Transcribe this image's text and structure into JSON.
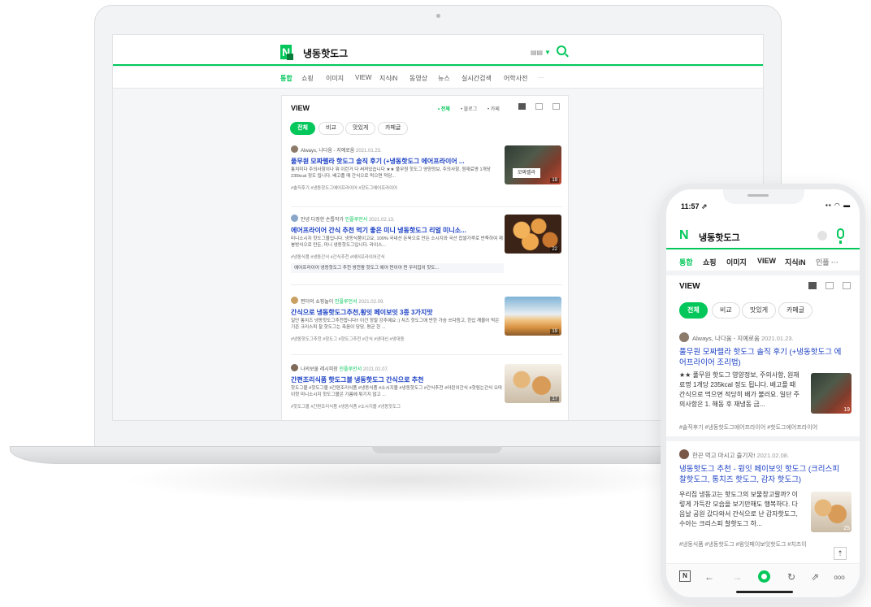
{
  "laptop": {
    "query": "냉동핫도그",
    "tabs": [
      "통합",
      "쇼핑",
      "이미지",
      "VIEW",
      "지식iN",
      "동영상",
      "뉴스",
      "실시간검색",
      "어학사전",
      "···"
    ],
    "view_title": "VIEW",
    "filters": [
      "• 전체",
      "• 블로그",
      "• 카페"
    ],
    "chips": [
      "전체",
      "비교",
      "맛있게",
      "카페글"
    ],
    "posts": [
      {
        "author": "Always, 나다움 - 지예로움",
        "influencer": "",
        "date": "2021.01.23.",
        "title": "풀무원 모짜렐라 핫도그 솔직 후기 (+냉동핫도그 에어프라이어 ...",
        "body": "통치미다 주의사항이나 뭐 이런거 다 써져있습니다 ★★ 풀무원 핫도그 영양정보, 주의사항, 원재료명 1개당 235kcal 정도 됩니다. 배고플 때 간식으로 먹으면 적당...",
        "tags": "#솔직후기   #냉동핫도그에어프라이어   #핫도그에어프라이어",
        "related": "",
        "thumb_label": "모짜렐라",
        "thumb_count": "19"
      },
      {
        "author": "안녕 다정한 손톱작가",
        "influencer": "인플루언서",
        "date": "2021.02.13.",
        "title": "에어프라이어 간식 추천 먹기 좋은 미니 냉동핫도그 리얼 미니소...",
        "body": "미니소시지 핫도그몰입니다. 냉동식품이고요, 100% 국내산 돈육으로 만든 소시지와 국산 찹쌀가루로 반죽하여 재봉방식으로 만든, 미니 냉동핫도그입니다. 라이스...",
        "tags": "#냉동식품   #냉동간식   #간식추천   #에어프라이어간식",
        "related": "에어프라이어 냉동핫도그 추천 쌍천팜 핫도그 에어 찐이야 찐 우리집이 핫도...",
        "thumb_label": "",
        "thumb_count": "22"
      },
      {
        "author": "찐더의 쇼핑놀이",
        "influencer": "인플루언서",
        "date": "2021.02.09.",
        "title": "간식으로 냉동핫도그추천,횡잇 페이보잇 3종 3가지맛",
        "body": "일단 통치즈 냉동핫도그추천합니다!! 이건 정말 강추예요 :) 치즈 핫도그에 반한 가슴 쓰다듬고, 한입 깨물어 먹은 기존 크리스피 찰 핫도그는 측음이 당당, 평균 한 ...",
        "tags": "#냉동핫도그추천   #핫도그   #핫도그추천   #간식   #냉대신   #냉대동",
        "related": "",
        "thumb_label": "",
        "thumb_count": "19"
      },
      {
        "author": "나의보물 레시피장",
        "influencer": "인플루언서",
        "date": "2021.02.07.",
        "title": "간편조리식품 핫도그볼 냉동핫도그 간식으로 추천",
        "body": "핫도그볼 #핫도그볼 #간편조리식품 #냉동식품 #소시지볼 #냉동핫도그 #간식추천 #어린이간식 #핫림는간식 오마이핫 미니소시지 핫도그볼은 기름에 튀기지 않고 ...",
        "tags": "#핫도그볼   #간편조리식품   #냉동식품   #소시지볼   #냉동핫도그",
        "related": "",
        "thumb_label": "",
        "thumb_count": "17"
      }
    ]
  },
  "phone": {
    "time": "11:57 ⇗",
    "status": "▪▪ ◠ ▬",
    "logo": "N",
    "query": "냉동핫도그",
    "tabs": [
      "통합",
      "쇼핑",
      "이미지",
      "VIEW",
      "지식iN",
      "인플 ···"
    ],
    "view_title": "VIEW",
    "chips": [
      "전체",
      "비교",
      "맛있게",
      "카페글"
    ],
    "posts": [
      {
        "author": "Always, 나다움 - 지예로움",
        "date": "2021.01.23.",
        "title": "풀무원 모짜렐라 핫도그 솔직 후기 (+냉동핫도그 에어프라이어 조리법)",
        "body": "★★ 풀무원 핫도그 영양정보, 주의사항, 원재료명 1개당 235kcal 정도 됩니다. 배고플 때 간식으로 먹으면 적당히 배가 불러요. 일단 주의사항은 1. 해동 후 재냉동 금...",
        "tags": "#솔직후기   #냉동핫도그에어프라이어   #핫도그에어프라이어",
        "thumb_count": "19"
      },
      {
        "author": "한끈 먹고 마시고 즐기자!",
        "date": "2021.02.08.",
        "title": "냉동핫도그 추천 - 윙잇 페이보잇 핫도그 (크리스피 찰핫도그, 통치즈 핫도그, 감자 핫도그)",
        "body": "우리집 냉동고는 핫도그의 보물창고랄까? 이렇게 가득찬 모습을 보기만해도 행복하다. 다음날 공원 갔다와서 간식으로 난 감자핫도그, 수아는 크리스피 찰핫도그 하...",
        "tags": "#냉동식품   #냉동핫도그   #윙잇페이보잇핫도그   #치즈이",
        "thumb_count": "25"
      }
    ],
    "totop": "⇡",
    "nav": [
      "N",
      "←",
      "→",
      "●",
      "↻",
      "⇗",
      "ooo"
    ]
  },
  "colors": {
    "accent": "#03c75a",
    "link": "#1a3fc4"
  }
}
